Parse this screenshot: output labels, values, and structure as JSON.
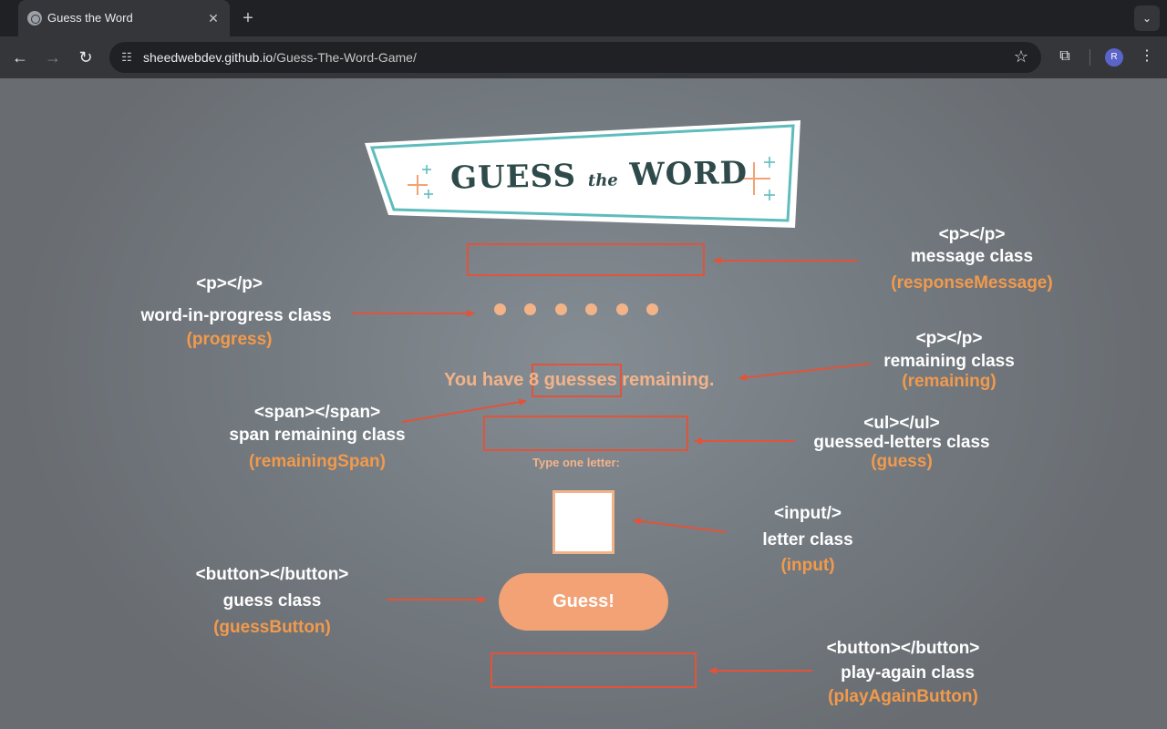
{
  "browser": {
    "tab_title": "Guess the Word",
    "tab_close": "✕",
    "new_tab": "+",
    "tab_menu": "⌄",
    "back": "←",
    "forward": "→",
    "reload": "↻",
    "site_info_icon": "☷",
    "url_domain": "sheedwebdev.github.io",
    "url_path": "/Guess-The-Word-Game/",
    "star": "☆",
    "extensions": "⧉",
    "profile_initial": "R",
    "menu": "⋮"
  },
  "logo": {
    "word1": "GUESS",
    "word2": "the",
    "word3": "WORD"
  },
  "game": {
    "word_in_progress_dots": [
      "●",
      "●",
      "●",
      "●",
      "●",
      "●"
    ],
    "remaining_text": "You have 8 guesses remaining.",
    "prompt_label": "Type one letter:",
    "letter_input_value": "",
    "guess_button_label": "Guess!"
  },
  "annotations": {
    "message": {
      "tag": "<p></p>",
      "cls": "message class",
      "id": "(responseMessage)"
    },
    "progress": {
      "tag": "<p></p>",
      "cls": "word-in-progress class",
      "id": "(progress)"
    },
    "remaining": {
      "tag": "<p></p>",
      "cls": "remaining class",
      "id": "(remaining)"
    },
    "span": {
      "tag": "<span></span>",
      "cls": "span remaining class",
      "id": "(remainingSpan)"
    },
    "guessed": {
      "tag": "<ul></ul>",
      "cls": "guessed-letters class",
      "id": "(guess)"
    },
    "input": {
      "tag": "<input/>",
      "cls": "letter class",
      "id": "(input)"
    },
    "guess_button": {
      "tag": "<button></button>",
      "cls": "guess class",
      "id": "(guessButton)"
    },
    "play_again": {
      "tag": "<button></button>",
      "cls": "play-again class",
      "id": "(playAgainButton)"
    }
  },
  "colors": {
    "accent_orange": "#f29a4c",
    "highlight_red": "#e2533a",
    "peach": "#f3b389",
    "logo_teal": "#5fbcbc"
  }
}
